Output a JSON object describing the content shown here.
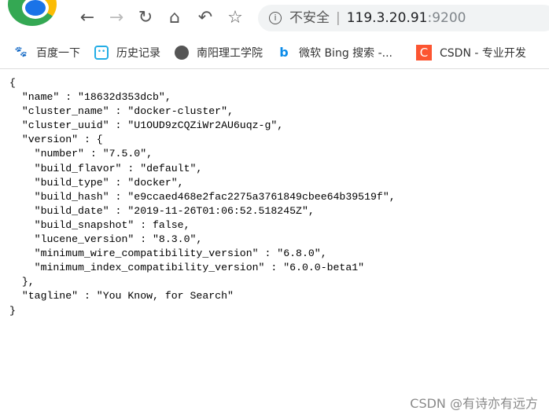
{
  "toolbar": {
    "back_icon": "arrow-left",
    "forward_icon": "arrow-right",
    "reload_icon": "reload",
    "home_icon": "home",
    "undo_icon": "undo",
    "star_icon": "star",
    "security_label": "不安全",
    "url_host": "119.3.20.91",
    "url_port": ":9200"
  },
  "bookmarks": [
    {
      "label": "百度一下",
      "icon": "baidu-paw",
      "color": "#2932e1"
    },
    {
      "label": "历史记录",
      "icon": "bilibili-tv",
      "color": "#23ade5"
    },
    {
      "label": "南阳理工学院",
      "icon": "globe",
      "color": "#555555"
    },
    {
      "label": "微软 Bing 搜索 -...",
      "icon": "bing",
      "color": "#0c8ce9"
    },
    {
      "label": "CSDN - 专业开发",
      "icon": "csdn-c",
      "color": "#fc5531"
    }
  ],
  "json_lines": [
    "{",
    "  \"name\" : \"18632d353dcb\",",
    "  \"cluster_name\" : \"docker-cluster\",",
    "  \"cluster_uuid\" : \"U1OUD9zCQZiWr2AU6uqz-g\",",
    "  \"version\" : {",
    "    \"number\" : \"7.5.0\",",
    "    \"build_flavor\" : \"default\",",
    "    \"build_type\" : \"docker\",",
    "    \"build_hash\" : \"e9ccaed468e2fac2275a3761849cbee64b39519f\",",
    "    \"build_date\" : \"2019-11-26T01:06:52.518245Z\",",
    "    \"build_snapshot\" : false,",
    "    \"lucene_version\" : \"8.3.0\",",
    "    \"minimum_wire_compatibility_version\" : \"6.8.0\",",
    "    \"minimum_index_compatibility_version\" : \"6.0.0-beta1\"",
    "  },",
    "  \"tagline\" : \"You Know, for Search\"",
    "}"
  ],
  "watermark": "CSDN @有诗亦有远方"
}
